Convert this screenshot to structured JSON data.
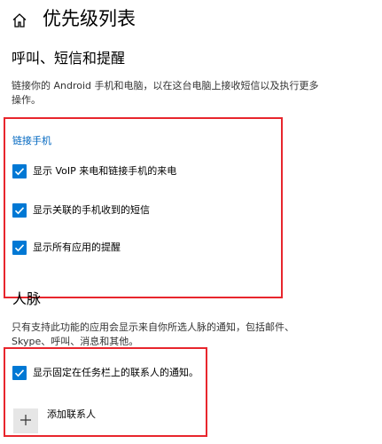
{
  "header": {
    "title": "优先级列表",
    "home_icon": "home-icon"
  },
  "calls_section": {
    "title": "呼叫、短信和提醒",
    "description_line1": "链接你的 Android 手机和电脑，以在这台电脑上接收短信以及执行更多",
    "description_line2": "操作。",
    "link_label": "链接手机",
    "checkboxes": [
      {
        "label": "显示 VoIP 来电和链接手机的来电",
        "checked": true
      },
      {
        "label": "显示关联的手机收到的短信",
        "checked": true
      },
      {
        "label": "显示所有应用的提醒",
        "checked": true
      }
    ]
  },
  "people_section": {
    "title": "人脉",
    "description_line1": "只有支持此功能的应用会显示来自你所选人脉的通知，包括邮件、",
    "description_line2": "Skype、呼叫、消息和其他。",
    "checkbox": {
      "label": "显示固定在任务栏上的联系人的通知。",
      "checked": true
    },
    "add_label": "添加联系人",
    "add_icon": "plus-icon"
  },
  "colors": {
    "accent": "#0078d4",
    "link": "#0067c0",
    "highlight_border": "#e8262d"
  }
}
